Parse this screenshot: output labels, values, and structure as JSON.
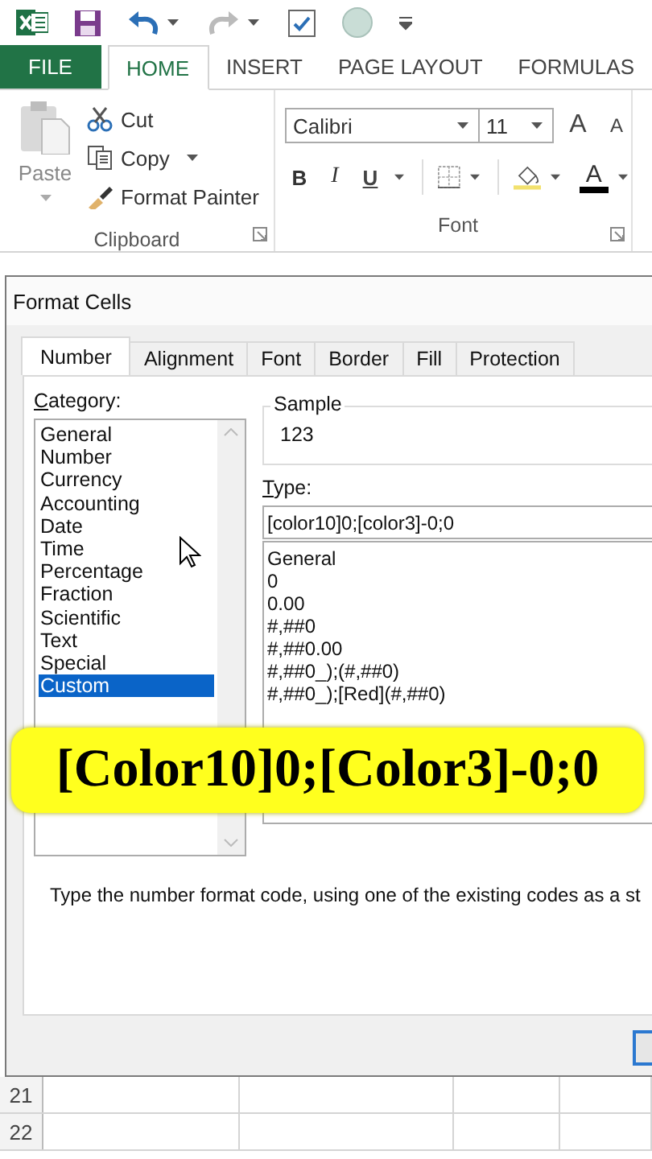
{
  "ribbon_tabs": [
    {
      "label": "FILE",
      "kind": "file",
      "selected": false
    },
    {
      "label": "HOME",
      "kind": "tab",
      "selected": true
    },
    {
      "label": "INSERT",
      "kind": "tab",
      "selected": false
    },
    {
      "label": "PAGE LAYOUT",
      "kind": "tab",
      "selected": false
    },
    {
      "label": "FORMULAS",
      "kind": "tab",
      "selected": false
    }
  ],
  "clipboard": {
    "paste": "Paste",
    "cut": "Cut",
    "copy": "Copy",
    "format_painter": "Format Painter",
    "label": "Clipboard"
  },
  "font": {
    "name": "Calibri",
    "size": "11",
    "grow": "A",
    "shrink": "A",
    "bold": "B",
    "italic": "I",
    "underline": "U",
    "color_letter": "A",
    "label": "Font"
  },
  "dialog": {
    "title": "Format Cells",
    "tabs": [
      {
        "label": "Number",
        "selected": true
      },
      {
        "label": "Alignment",
        "selected": false
      },
      {
        "label": "Font",
        "selected": false
      },
      {
        "label": "Border",
        "selected": false
      },
      {
        "label": "Fill",
        "selected": false
      },
      {
        "label": "Protection",
        "selected": false
      }
    ],
    "category_label": "Category:",
    "categories": [
      {
        "label": "General",
        "selected": false
      },
      {
        "label": "Number",
        "selected": false
      },
      {
        "label": "Currency",
        "selected": false
      },
      {
        "label": "Accounting",
        "selected": false
      },
      {
        "label": "Date",
        "selected": false
      },
      {
        "label": "Time",
        "selected": false
      },
      {
        "label": "Percentage",
        "selected": false
      },
      {
        "label": "Fraction",
        "selected": false
      },
      {
        "label": "Scientific",
        "selected": false
      },
      {
        "label": "Text",
        "selected": false
      },
      {
        "label": "Special",
        "selected": false
      },
      {
        "label": "Custom",
        "selected": true
      }
    ],
    "sample_label": "Sample",
    "sample": "123",
    "type_label": "Type:",
    "type_value": "[color10]0;[color3]-0;0",
    "formats": [
      "General",
      "0",
      "0.00",
      "#,##0",
      "#,##0.00",
      "#,##0_);(#,##0)",
      "#,##0_);[Red](#,##0)"
    ],
    "description": "Type the number format code, using one of the existing codes as a st"
  },
  "caption": "[Color10]0;[Color3]-0;0",
  "sheet": {
    "row_numbers": [
      "21",
      "22"
    ]
  }
}
